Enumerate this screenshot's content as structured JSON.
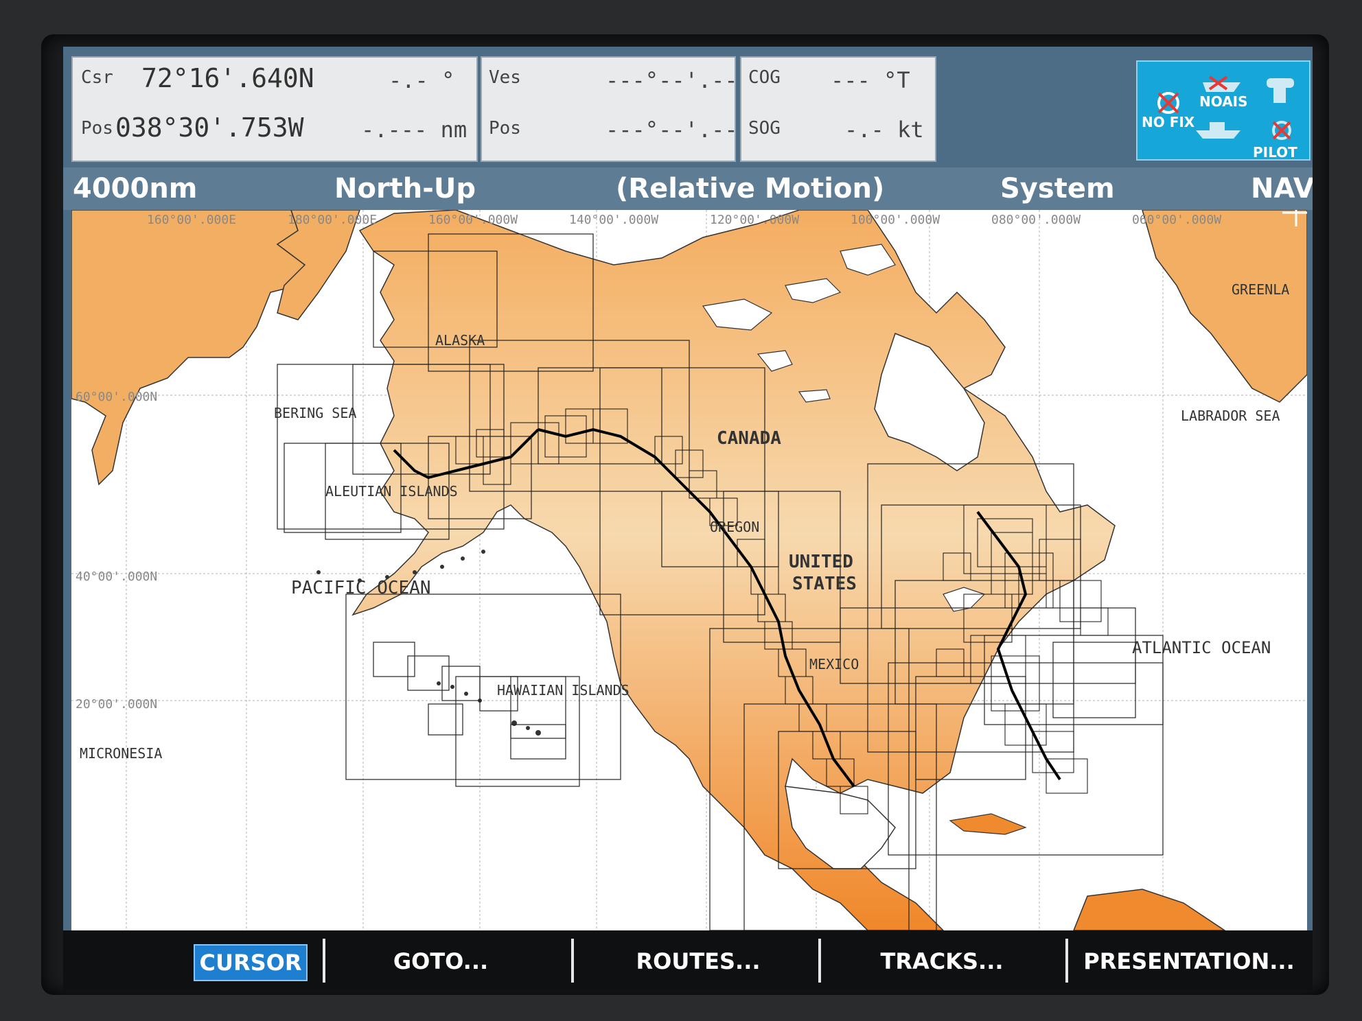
{
  "panel_cursor": {
    "csr_label": "Csr",
    "pos_label": "Pos",
    "lat": "72°16'.640N",
    "lon": "038°30'.753W",
    "bearing": "-.- °",
    "range": "-.--- nm"
  },
  "panel_vessel": {
    "ves_label": "Ves",
    "pos_label": "Pos",
    "lat": "---°--'.---",
    "lon": "---°--'.---"
  },
  "panel_course": {
    "cog_label": "COG",
    "sog_label": "SOG",
    "cog_value": "--- °T",
    "sog_value": "-.- kt"
  },
  "status_icons": {
    "noais": "NOAIS",
    "nofix": "NO FIX",
    "pilot": "PILOT"
  },
  "statusbar": {
    "range": "4000nm",
    "orientation": "North-Up",
    "motion": "(Relative Motion)",
    "mode": "System",
    "page": "NAV"
  },
  "chart": {
    "longitude_labels": [
      "160°00'.000E",
      "180°00'.000E",
      "160°00'.000W",
      "140°00'.000W",
      "120°00'.000W",
      "100°00'.000W",
      "080°00'.000W",
      "060°00'.000W"
    ],
    "latitude_labels": [
      "60°00'.000N",
      "40°00'.000N",
      "20°00'.000N"
    ],
    "place_labels": {
      "alaska": "ALASKA",
      "bering_sea": "BERING SEA",
      "aleutian": "ALEUTIAN ISLANDS",
      "canada": "CANADA",
      "oregon": "OREGON",
      "united": "UNITED",
      "states": "STATES",
      "pacific": "PACIFIC OCEAN",
      "hawaiian": "HAWAIIAN ISLANDS",
      "micronesia": "MICRONESIA",
      "mexico": "MEXICO",
      "atlantic": "ATLANTIC OCEAN",
      "labrador": "LABRADOR SEA",
      "greenland": "GREENLA"
    },
    "colors": {
      "land": "#f2ae62",
      "land_light": "#f6dcb4",
      "sea": "#ffffff",
      "grid": "#aaaaaa"
    }
  },
  "softkeys": [
    "CURSOR",
    "GOTO...",
    "ROUTES...",
    "TRACKS...",
    "PRESENTATION..."
  ]
}
